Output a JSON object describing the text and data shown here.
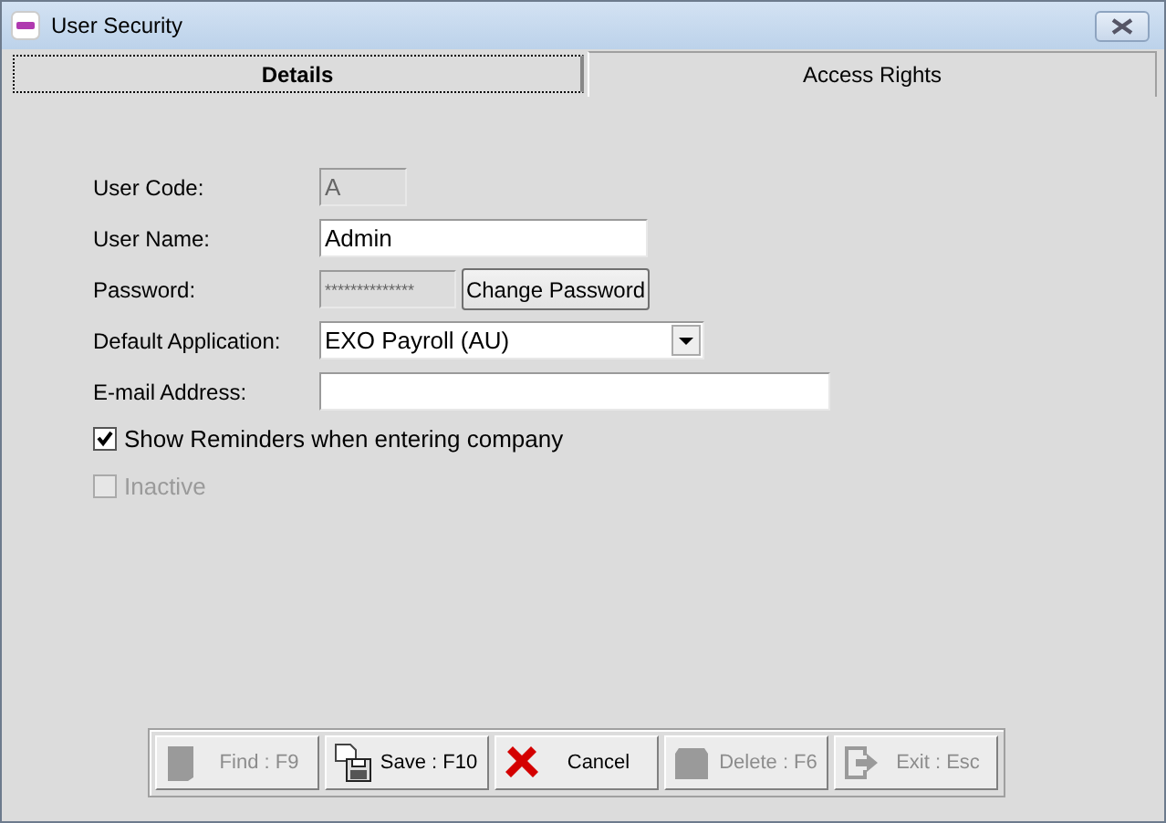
{
  "window": {
    "title": "User Security"
  },
  "tabs": [
    {
      "label": "Details",
      "selected": true
    },
    {
      "label": "Access Rights",
      "selected": false
    }
  ],
  "fields": [
    {
      "kind": "text",
      "label": "User Code:",
      "value": "A",
      "disabled": true
    },
    {
      "kind": "text",
      "label": "User Name:",
      "value": "Admin",
      "disabled": false
    },
    {
      "kind": "password",
      "label": "Password:",
      "value": "**************",
      "disabled": true,
      "button": "Change Password"
    },
    {
      "kind": "dropdown",
      "label": "Default Application:",
      "value": "EXO Payroll (AU)",
      "disabled": false
    },
    {
      "kind": "text",
      "label": "E-mail Address:",
      "disabled": false
    }
  ],
  "checkboxes": [
    {
      "label": "Show Reminders when entering company",
      "checked": true,
      "disabled": false
    },
    {
      "label": "Inactive",
      "checked": false,
      "disabled": true
    }
  ],
  "toolbar": [
    {
      "label": "Find : F9",
      "disabled": true
    },
    {
      "label": "Save : F10",
      "disabled": false
    },
    {
      "label": "Cancel",
      "disabled": false
    },
    {
      "label": "Delete : F6",
      "disabled": true
    },
    {
      "label": "Exit : Esc",
      "disabled": true
    }
  ]
}
